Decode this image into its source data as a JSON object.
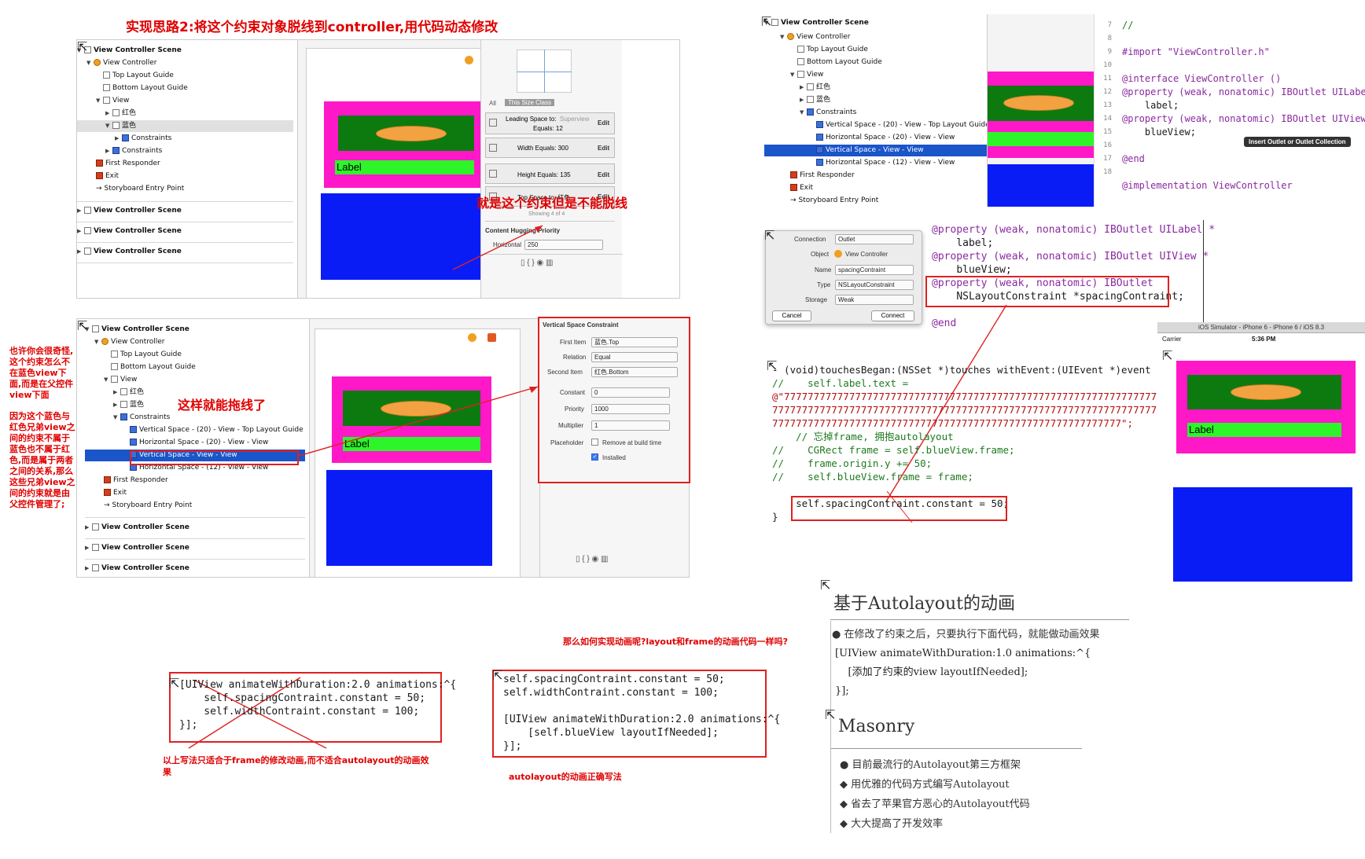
{
  "top_title": "实现思路2:将这个约束对象脱线到controller,用代码动态修改",
  "outline_scene": "View Controller Scene",
  "outline_vc": "View Controller",
  "outline_top_guide": "Top Layout Guide",
  "outline_bottom_guide": "Bottom Layout Guide",
  "outline_view": "View",
  "outline_red": "红色",
  "outline_blue": "蓝色",
  "outline_constraints": "Constraints",
  "outline_first_responder": "First Responder",
  "outline_exit": "Exit",
  "outline_entry": "Storyboard Entry Point",
  "c_vspace_top": "Vertical Space - (20) - View - Top Layout Guide",
  "c_hspace_20": "Horizontal Space - (20) - View - View",
  "c_vspace_view": "Vertical Space - View - View",
  "c_hspace_12": "Horizontal Space - (12) - View - View",
  "label_text": "Label",
  "panel1": {
    "tab_all": "All",
    "tab_size_class": "This Size Class",
    "leading_space": "Leading Space to:",
    "leading_target": "Superview",
    "equals_12": "Equals:  12",
    "width_equals": "Width Equals:  300",
    "height_equals": "Height Equals:  135",
    "top_space": "Top Space to:  红色",
    "edit": "Edit",
    "showing": "Showing 4 of 4",
    "hugging": "Content Hugging Priority",
    "horizontal": "Horizontal",
    "horizontal_val": "250",
    "cannot_drag": "就是这个约束但是不能脱线"
  },
  "panel2": {
    "title": "Vertical Space Constraint",
    "first_item": "First Item",
    "first_item_val": "蓝色.Top",
    "relation": "Relation",
    "relation_val": "Equal",
    "second_item": "Second Item",
    "second_item_val": "红色.Bottom",
    "constant": "Constant",
    "constant_val": "0",
    "priority": "Priority",
    "priority_val": "1000",
    "multiplier": "Multiplier",
    "multiplier_val": "1",
    "placeholder": "Placeholder",
    "remove_build": "Remove at build time",
    "installed": "Installed",
    "can_drag": "这样就能拖线了"
  },
  "left_note1": "也许你会很奇怪,这个约束怎么不在蓝色view下面,而是在父控件view下面",
  "left_note2": "因为这个蓝色与红色兄弟view之间的约束不属于蓝色也不属于红色,而是属于两者之间的关系,那么这些兄弟view之间的约束就是由父控件管理了;",
  "header_code": {
    "line7": "//",
    "line9": "#import \"ViewController.h\"",
    "line11": "@interface ViewController ()",
    "line12": "@property (weak, nonatomic) IBOutlet UILabel *",
    "line12b": "label;",
    "line13": "@property (weak, nonatomic) IBOutlet UIView *",
    "line13b": "blueView;",
    "line15": "@end",
    "line17": "@implementation ViewController",
    "nums": [
      "7",
      "8",
      "9",
      "10",
      "11",
      "12",
      "13",
      "14",
      "15",
      "16",
      "17",
      "18"
    ],
    "tooltip": "Insert Outlet or Outlet Collection"
  },
  "conn_dialog": {
    "connection": "Connection",
    "connection_val": "Outlet",
    "object": "Object",
    "object_val": "View Controller",
    "name": "Name",
    "name_val": "spacingContraint",
    "type": "Type",
    "type_val": "NSLayoutConstraint",
    "storage": "Storage",
    "storage_val": "Weak",
    "cancel": "Cancel",
    "connect": "Connect"
  },
  "prop_code": {
    "l1": "@property (weak, nonatomic) IBOutlet UILabel *",
    "l2": "label;",
    "l3": "@property (weak, nonatomic) IBOutlet UIView *",
    "l4": "blueView;",
    "l5": "@property (weak, nonatomic) IBOutlet",
    "l6": "NSLayoutConstraint *spacingContraint;",
    "l7": "@end"
  },
  "touch_code": {
    "l1": "- (void)touchesBegan:(NSSet *)touches withEvent:(UIEvent *)event {",
    "l2": "//    self.label.text =",
    "l3": "@\"77777777777777777777777777777777777777777777777777777777777777777",
    "l4": "777777777777777777777777777777777777777777777777777777777777777777",
    "l5": "77777777777777777777777777777777777777777777777777777777777\";",
    "l6": "    // 忘掉frame, 拥抱autolayout",
    "l7": "//    CGRect frame = self.blueView.frame;",
    "l8": "//    frame.origin.y += 50;",
    "l9": "//    self.blueView.frame = frame;",
    "l10": "    self.spacingContraint.constant = 50;",
    "l11": "}"
  },
  "simulator": {
    "title": "iOS Simulator - iPhone 6 - iPhone 6 / iOS 8.3",
    "carrier": "Carrier",
    "time": "5:36 PM"
  },
  "question": "那么如何实现动画呢?layout和frame的动画代码一样吗?",
  "wrong_code": {
    "l1": "[UIView animateWithDuration:2.0 animations:^{",
    "l2": "    self.spacingContraint.constant = 50;",
    "l3": "    self.widthContraint.constant = 100;",
    "l4": "}];"
  },
  "wrong_note": "以上写法只适合于frame的修改动画,而不适合autolayout的动画效果",
  "right_code": {
    "l1": "self.spacingContraint.constant = 50;",
    "l2": "self.widthContraint.constant = 100;",
    "l3": "[UIView animateWithDuration:2.0 animations:^{",
    "l4": "    [self.blueView layoutIfNeeded];",
    "l5": "}];"
  },
  "right_note": "autolayout的动画正确写法",
  "slide": {
    "title": "基于Autolayout的动画",
    "b1": "在修改了约束之后，只要执行下面代码，就能做动画效果",
    "c1": "[UIView animateWithDuration:1.0 animations:^{",
    "c2": "    [添加了约束的view layoutIfNeeded];",
    "c3": "}];",
    "title2": "Masonry",
    "m1": "目前最流行的Autolayout第三方框架",
    "m2": "用优雅的代码方式编写Autolayout",
    "m3": "省去了苹果官方恶心的Autolayout代码",
    "m4": "大大提高了开发效率"
  }
}
